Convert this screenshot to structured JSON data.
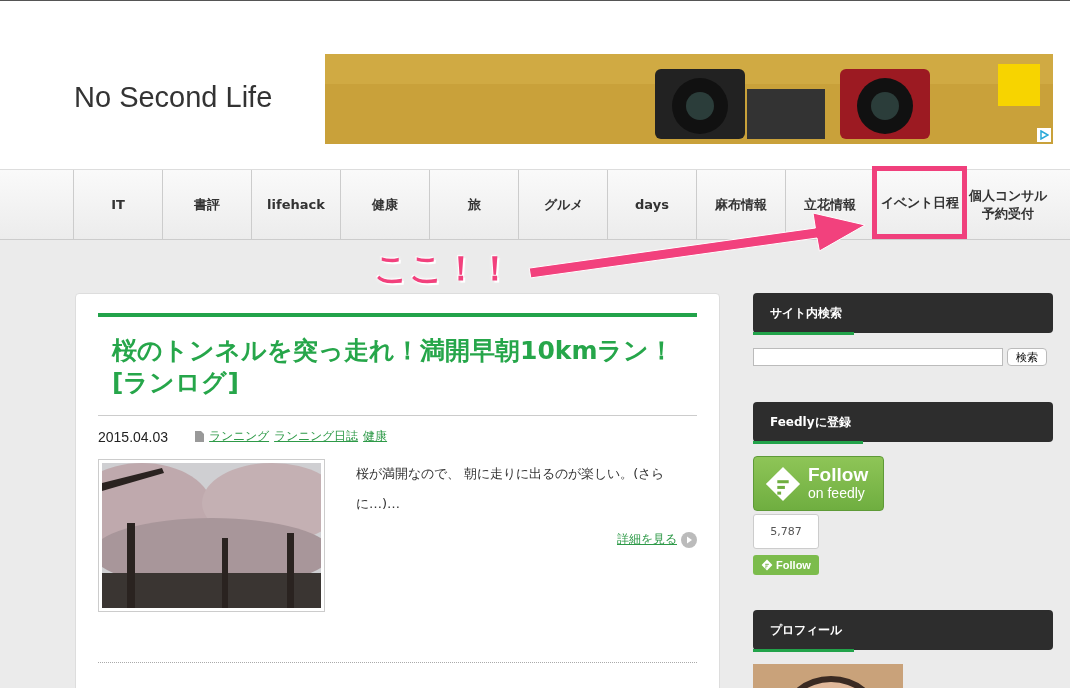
{
  "site_title": "No Second Life",
  "nav": {
    "items": [
      {
        "label": "IT",
        "highlighted": false
      },
      {
        "label": "書評",
        "highlighted": false
      },
      {
        "label": "lifehack",
        "highlighted": false
      },
      {
        "label": "健康",
        "highlighted": false
      },
      {
        "label": "旅",
        "highlighted": false
      },
      {
        "label": "グルメ",
        "highlighted": false
      },
      {
        "label": "days",
        "highlighted": false
      },
      {
        "label": "麻布情報",
        "highlighted": false
      },
      {
        "label": "立花情報",
        "highlighted": false
      },
      {
        "label": "イベント日程",
        "highlighted": true
      },
      {
        "label": "個人コンサル予約受付",
        "highlighted": false
      }
    ]
  },
  "annotation": {
    "text": "ここ！！"
  },
  "post": {
    "title": "桜のトンネルを突っ走れ！満開早朝10kmラン！ [ランログ]",
    "date": "2015.04.03",
    "categories": [
      "ランニング",
      "ランニング日誌",
      "健康"
    ],
    "excerpt": "桜が満開なので、 朝に走りに出るのが楽しい。(さらに…)…",
    "more": "詳細を見る"
  },
  "sidebar": {
    "widgets": [
      {
        "kind": "search",
        "title": "サイト内検索",
        "button": "検索"
      },
      {
        "kind": "feedly",
        "title": "Feedlyに登録",
        "follow_title": "Follow",
        "follow_sub": "on feedly",
        "count": "5,787",
        "small_follow": "Follow"
      },
      {
        "kind": "profile",
        "title": "プロフィール"
      }
    ]
  }
}
